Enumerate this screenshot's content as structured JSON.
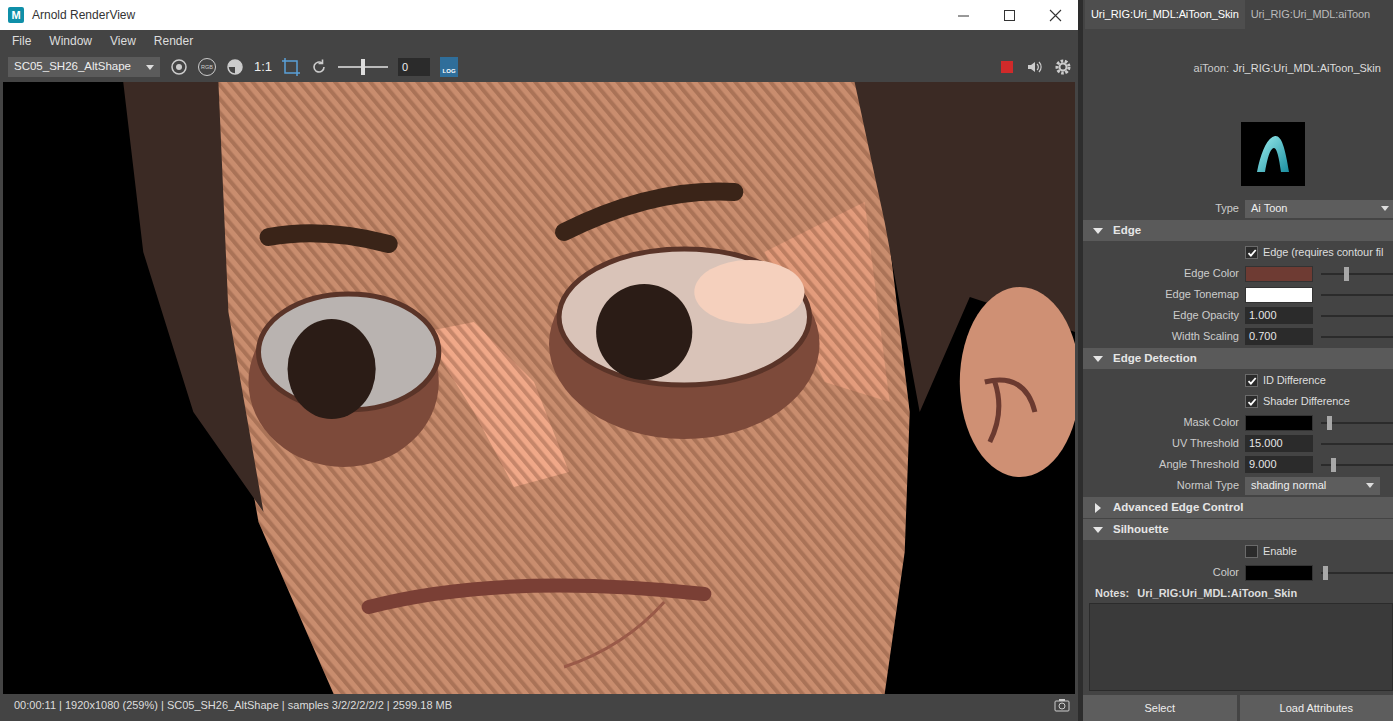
{
  "window": {
    "logo": "M",
    "title": "Arnold RenderView"
  },
  "menu": [
    {
      "label": "File"
    },
    {
      "label": "Window"
    },
    {
      "label": "View"
    },
    {
      "label": "Render"
    }
  ],
  "toolbar": {
    "camera": "SC05_SH26_AltShape",
    "rgb": "RGB",
    "ratio": "1:1",
    "exposure": {
      "level": 0.5,
      "value": "0"
    },
    "log": "LOG"
  },
  "status_bar": {
    "text": "00:00:11 | 1920x1080 (259%) | SC05_SH26_AltShape  | samples 3/2/2/2/2/2 | 2599.18 MB"
  },
  "attribute_editor": {
    "tabs": [
      {
        "label": "Uri_RIG:Uri_MDL:AiToon_Skin",
        "selected": true
      },
      {
        "label": "Uri_RIG:Uri_MDL:aiToon",
        "selected": false
      }
    ],
    "node": {
      "label": "aiToon:",
      "value": "Jri_RIG:Uri_MDL:AiToon_Skin"
    },
    "type": {
      "label": "Type",
      "value": "Ai Toon"
    },
    "sections": [
      {
        "title": "Edge",
        "expanded": true,
        "rows": [
          {
            "kind": "checkbox",
            "label": "Edge (requires contour fil",
            "checked": true
          },
          {
            "kind": "color",
            "label": "Edge Color",
            "color": "#6e3b33",
            "level": 0.19
          },
          {
            "kind": "color",
            "label": "Edge Tonemap",
            "color": "#ffffff"
          },
          {
            "kind": "float",
            "label": "Edge Opacity",
            "value": "1.000"
          },
          {
            "kind": "float",
            "label": "Width Scaling",
            "value": "0.700"
          }
        ]
      },
      {
        "title": "Edge Detection",
        "expanded": true,
        "rows": [
          {
            "kind": "checkbox",
            "label": "ID Difference",
            "checked": true
          },
          {
            "kind": "checkbox",
            "label": "Shader Difference",
            "checked": true
          },
          {
            "kind": "color",
            "label": "Mask Color",
            "color": "#000000",
            "level": 0.06
          },
          {
            "kind": "float",
            "label": "UV Threshold",
            "value": "15.000"
          },
          {
            "kind": "float",
            "label": "Angle Threshold",
            "value": "9.000",
            "level": 0.09
          },
          {
            "kind": "dropdown",
            "label": "Normal Type",
            "value": "shading normal"
          }
        ]
      },
      {
        "title": "Advanced Edge Control",
        "expanded": false,
        "rows": []
      },
      {
        "title": "Silhouette",
        "expanded": true,
        "rows": [
          {
            "kind": "checkbox",
            "label": "Enable",
            "checked": false
          },
          {
            "kind": "color",
            "label": "Color",
            "color": "#000000",
            "level": 0.03
          }
        ]
      }
    ],
    "notes": {
      "label": "Notes:",
      "value": "Uri_RIG:Uri_MDL:AiToon_Skin"
    },
    "buttons": [
      {
        "label": "Select"
      },
      {
        "label": "Load Attributes"
      }
    ]
  }
}
